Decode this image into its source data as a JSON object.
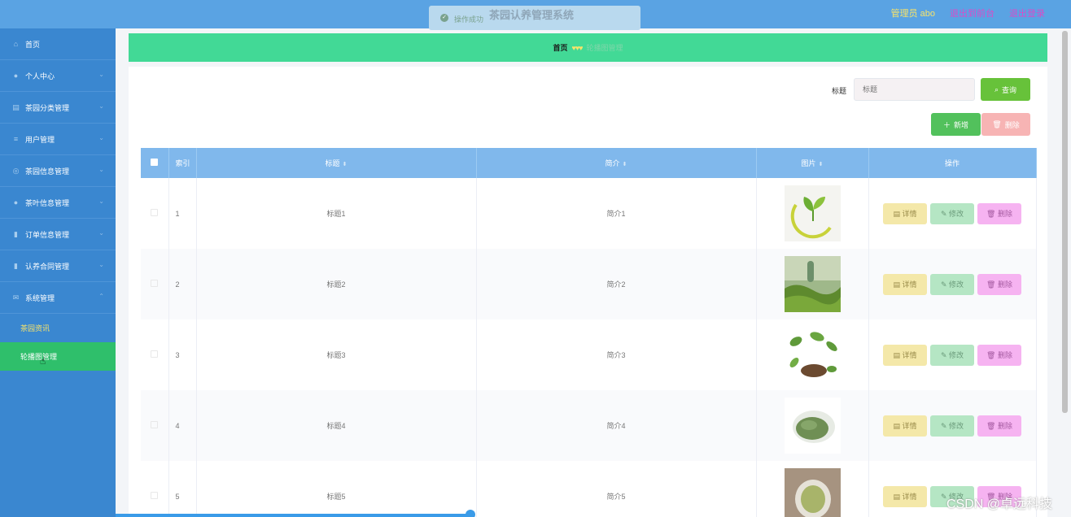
{
  "header": {
    "title": "茶园认养管理系统",
    "admin_label": "管理员 abo",
    "links": [
      "退出到前台",
      "退出登录"
    ]
  },
  "toast": {
    "text": "操作成功"
  },
  "sidebar": {
    "items": [
      {
        "label": "首页",
        "icon": "home-icon"
      },
      {
        "label": "个人中心",
        "icon": "user-icon"
      },
      {
        "label": "茶园分类管理",
        "icon": "bank-icon"
      },
      {
        "label": "用户管理",
        "icon": "list-icon"
      },
      {
        "label": "茶园信息管理",
        "icon": "compass-icon"
      },
      {
        "label": "茶叶信息管理",
        "icon": "user-icon"
      },
      {
        "label": "订单信息管理",
        "icon": "clipboard-icon"
      },
      {
        "label": "认养合同管理",
        "icon": "clipboard-icon"
      },
      {
        "label": "系统管理",
        "icon": "mail-icon"
      }
    ],
    "sub_items": [
      "茶园资讯",
      "轮播图管理"
    ]
  },
  "breadcrumb": {
    "home": "首页",
    "current": "轮播图管理"
  },
  "search": {
    "label": "标题",
    "placeholder": "标题",
    "button": "查询"
  },
  "actions": {
    "add": "新增",
    "delete": "删除"
  },
  "table": {
    "headers": {
      "index": "索引",
      "title": "标题",
      "intro": "简介",
      "image": "图片",
      "ops": "操作"
    },
    "rows": [
      {
        "index": "1",
        "title": "标题1",
        "intro": "简介1"
      },
      {
        "index": "2",
        "title": "标题2",
        "intro": "简介2"
      },
      {
        "index": "3",
        "title": "标题3",
        "intro": "简介3"
      },
      {
        "index": "4",
        "title": "标题4",
        "intro": "简介4"
      },
      {
        "index": "5",
        "title": "标题5",
        "intro": "简介5"
      }
    ],
    "op_labels": {
      "detail": "详情",
      "edit": "修改",
      "delete": "删除"
    }
  },
  "watermark": "CSDN @卓远科技"
}
